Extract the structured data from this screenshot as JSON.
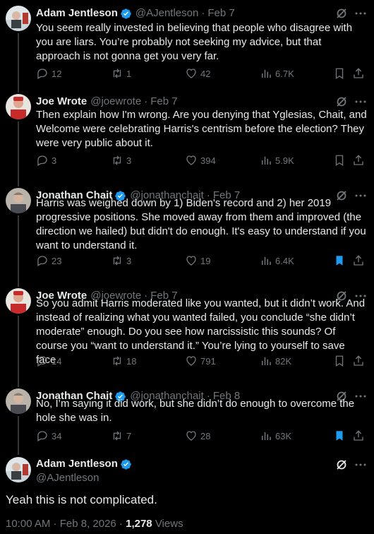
{
  "colors": {
    "background": "#000000",
    "text": "#e7e9ea",
    "muted": "#71767b",
    "verified": "#1d9bf0",
    "bookmark_active": "#1d9bf0"
  },
  "tweets": [
    {
      "name": "Adam Jentleson",
      "handle": "@AJentleson",
      "date": "Feb 7",
      "verified": true,
      "text": "You seem really invested in believing that people who disagree with you are liars. You’re probably not seeking my advice, but that approach is not gonna get you very far.",
      "replies": "12",
      "reposts": "1",
      "likes": "42",
      "views": "6.7K",
      "bookmarked": false
    },
    {
      "name": "Joe Wrote",
      "handle": "@joewrote",
      "date": "Feb 7",
      "verified": false,
      "text": "Then explain how I'm wrong. Are you denying that Yglesias, Chait, and Welcome were celebrating Harris's centrism before the election? They were very public about it.",
      "replies": "3",
      "reposts": "3",
      "likes": "394",
      "views": "5.9K",
      "bookmarked": false
    },
    {
      "name": "Jonathan Chait",
      "handle": "@jonathanchait",
      "date": "Feb 7",
      "verified": true,
      "text": "Harris was weighed down by 1) Biden's record and 2) her 2019 progressive positions. She moved away from them and improved (the direction we hailed) but didn't do enough. It's easy to understand if you want to understand it.",
      "replies": "23",
      "reposts": "3",
      "likes": "19",
      "views": "6.4K",
      "bookmarked": true
    },
    {
      "name": "Joe Wrote",
      "handle": "@joewrote",
      "date": "Feb 7",
      "verified": false,
      "text": "So you admit Harris moderated like you wanted, but it didn’t work. And instead of realizing what you wanted failed, you conclude “she didn’t moderate” enough. Do you see how narcissistic this sounds? Of course you “want to understand it.” You’re lying to yourself to save face.",
      "replies": "14",
      "reposts": "18",
      "likes": "791",
      "views": "82K",
      "bookmarked": false
    },
    {
      "name": "Jonathan Chait",
      "handle": "@jonathanchait",
      "date": "Feb 8",
      "verified": true,
      "text": "No, I’m saying it did work, but she didn’t do enough to overcome the hole she was in.",
      "replies": "34",
      "reposts": "7",
      "likes": "28",
      "views": "63K",
      "bookmarked": true
    }
  ],
  "focus": {
    "name": "Adam Jentleson",
    "handle": "@AJentleson",
    "verified": true,
    "text": "Yeah this is not complicated.",
    "timestamp": "10:00 AM · Feb 8, 2026 · ",
    "views_count": "1,278",
    "views_label": " Views"
  }
}
